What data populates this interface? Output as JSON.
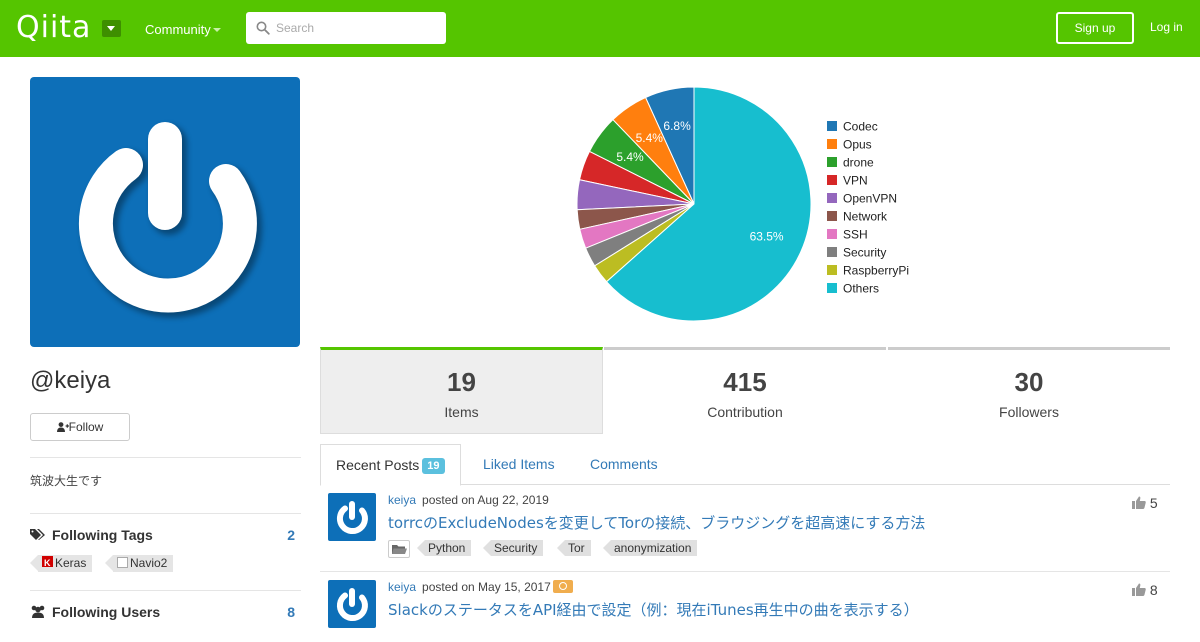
{
  "header": {
    "logo": "Qiita",
    "community_label": "Community",
    "search_placeholder": "Search",
    "signup_label": "Sign up",
    "login_label": "Log in"
  },
  "colors": {
    "brand": "#55c500",
    "link": "#337ab7",
    "avatar_bg": "#0d6fb8"
  },
  "profile": {
    "username": "@keiya",
    "follow_label": "Follow",
    "bio": "筑波大生です",
    "following_tags_title": "Following Tags",
    "following_tags_count": "2",
    "tags": [
      {
        "label": "Keras",
        "icon": "keras-icon"
      },
      {
        "label": "Navio2",
        "icon": "broken-image-icon"
      }
    ],
    "following_users_title": "Following Users",
    "following_users_count": "8"
  },
  "chart_data": {
    "type": "pie",
    "legend_position": "right",
    "slices": [
      {
        "name": "Codec",
        "value": 6.8,
        "color": "#1f77b4",
        "label": "6.8%"
      },
      {
        "name": "Opus",
        "value": 5.4,
        "color": "#ff7f0e",
        "label": "5.4%"
      },
      {
        "name": "drone",
        "value": 5.4,
        "color": "#2ca02c",
        "label": "5.4%"
      },
      {
        "name": "VPN",
        "value": 4.1,
        "color": "#d62728",
        "label": ""
      },
      {
        "name": "OpenVPN",
        "value": 4.1,
        "color": "#9467bd",
        "label": ""
      },
      {
        "name": "Network",
        "value": 2.7,
        "color": "#8c564b",
        "label": ""
      },
      {
        "name": "SSH",
        "value": 2.7,
        "color": "#e377c2",
        "label": ""
      },
      {
        "name": "Security",
        "value": 2.7,
        "color": "#7f7f7f",
        "label": ""
      },
      {
        "name": "RaspberryPi",
        "value": 2.7,
        "color": "#bcbd22",
        "label": ""
      },
      {
        "name": "Others",
        "value": 63.5,
        "color": "#17becf",
        "label": "63.5%"
      }
    ]
  },
  "stats": [
    {
      "value": "19",
      "label": "Items"
    },
    {
      "value": "415",
      "label": "Contribution"
    },
    {
      "value": "30",
      "label": "Followers"
    }
  ],
  "tabs": [
    {
      "label": "Recent Posts",
      "badge": "19"
    },
    {
      "label": "Liked Items"
    },
    {
      "label": "Comments"
    }
  ],
  "posts": [
    {
      "author": "keiya",
      "posted": "posted on Aug 22, 2019",
      "title": "torrcのExcludeNodesを変更してTorの接続、ブラウジングを超高速にする方法",
      "likes": "5",
      "tags": [
        "Python",
        "Security",
        "Tor",
        "anonymization"
      ]
    },
    {
      "author": "keiya",
      "posted": "posted on May 15, 2017",
      "title": "SlackのステータスをAPI経由で設定（例：現在iTunes再生中の曲を表示する）",
      "likes": "8"
    }
  ]
}
